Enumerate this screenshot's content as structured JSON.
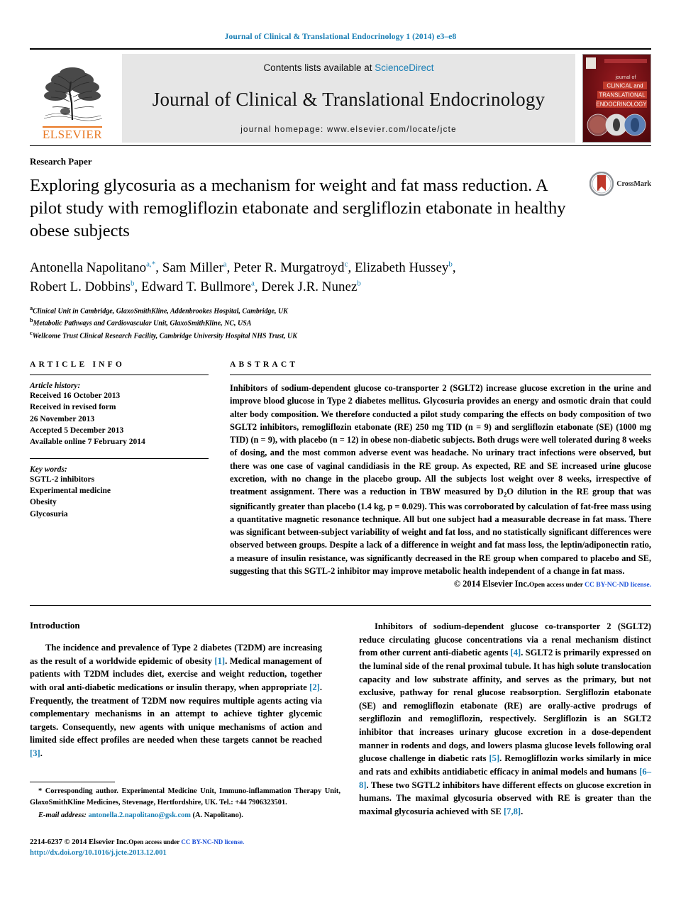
{
  "running_head": "Journal of Clinical & Translational Endocrinology 1 (2014) e3–e8",
  "masthead": {
    "contents_prefix": "Contents lists available at ",
    "sciencedirect": "ScienceDirect",
    "journal_name": "Journal of Clinical & Translational Endocrinology",
    "homepage": "journal homepage: www.elsevier.com/locate/jcte",
    "publisher_wordmark": "ELSEVIER",
    "cover": {
      "line1": "journal of",
      "line2": "CLINICAL and",
      "line3": "TRANSLATIONAL",
      "line4": "ENDOCRINOLOGY"
    }
  },
  "article": {
    "type": "Research Paper",
    "title": "Exploring glycosuria as a mechanism for weight and fat mass reduction. A pilot study with remogliflozin etabonate and sergliflozin etabonate in healthy obese subjects",
    "crossmark_label": "CrossMark",
    "authors_line1": "Antonella Napolitano",
    "authors": [
      {
        "name": "Antonella Napolitano",
        "sup": "a,*"
      },
      {
        "name": "Sam Miller",
        "sup": "a"
      },
      {
        "name": "Peter R. Murgatroyd",
        "sup": "c"
      },
      {
        "name": "Elizabeth Hussey",
        "sup": "b"
      },
      {
        "name": "Robert L. Dobbins",
        "sup": "b"
      },
      {
        "name": "Edward T. Bullmore",
        "sup": "a"
      },
      {
        "name": "Derek J.R. Nunez",
        "sup": "b"
      }
    ],
    "affiliations": [
      {
        "sup": "a",
        "text": "Clinical Unit in Cambridge, GlaxoSmithKline, Addenbrookes Hospital, Cambridge, UK"
      },
      {
        "sup": "b",
        "text": "Metabolic Pathways and Cardiovascular Unit, GlaxoSmithKline, NC, USA"
      },
      {
        "sup": "c",
        "text": "Wellcome Trust Clinical Research Facility, Cambridge University Hospital NHS Trust, UK"
      }
    ]
  },
  "article_info": {
    "heading": "ARTICLE INFO",
    "history_title": "Article history:",
    "history": [
      "Received 16 October 2013",
      "Received in revised form",
      "26 November 2013",
      "Accepted 5 December 2013",
      "Available online 7 February 2014"
    ],
    "keywords_title": "Key words:",
    "keywords": [
      "SGTL-2 inhibitors",
      "Experimental medicine",
      "Obesity",
      "Glycosuria"
    ]
  },
  "abstract": {
    "heading": "ABSTRACT",
    "text": "Inhibitors of sodium-dependent glucose co-transporter 2 (SGLT2) increase glucose excretion in the urine and improve blood glucose in Type 2 diabetes mellitus. Glycosuria provides an energy and osmotic drain that could alter body composition. We therefore conducted a pilot study comparing the effects on body composition of two SGLT2 inhibitors, remogliflozin etabonate (RE) 250 mg TID (n = 9) and sergliflozin etabonate (SE) (1000 mg TID) (n = 9), with placebo (n = 12) in obese non-diabetic subjects. Both drugs were well tolerated during 8 weeks of dosing, and the most common adverse event was headache. No urinary tract infections were observed, but there was one case of vaginal candidiasis in the RE group. As expected, RE and SE increased urine glucose excretion, with no change in the placebo group. All the subjects lost weight over 8 weeks, irrespective of treatment assignment. There was a reduction in TBW measured by D2O dilution in the RE group that was significantly greater than placebo (1.4 kg, p = 0.029). This was corroborated by calculation of fat-free mass using a quantitative magnetic resonance technique. All but one subject had a measurable decrease in fat mass. There was significant between-subject variability of weight and fat loss, and no statistically significant differences were observed between groups. Despite a lack of a difference in weight and fat mass loss, the leptin/adiponectin ratio, a measure of insulin resistance, was significantly decreased in the RE group when compared to placebo and SE, suggesting that this SGTL-2 inhibitor may improve metabolic health independent of a change in fat mass.",
    "copyright_main": "© 2014 Elsevier Inc.",
    "copyright_access": "Open access under ",
    "copyright_license": "CC BY-NC-ND license."
  },
  "introduction": {
    "heading": "Introduction",
    "left_paragraphs": [
      "The incidence and prevalence of Type 2 diabetes (T2DM) are increasing as the result of a worldwide epidemic of obesity [1]. Medical management of patients with T2DM includes diet, exercise and weight reduction, together with oral anti-diabetic medications or insulin therapy, when appropriate [2]. Frequently, the treatment of T2DM now requires multiple agents acting via complementary mechanisms in an attempt to achieve tighter glycemic targets. Consequently, new agents with unique mechanisms of action and limited side effect profiles are needed when these targets cannot be reached [3]."
    ],
    "right_paragraphs": [
      "Inhibitors of sodium-dependent glucose co-transporter 2 (SGLT2) reduce circulating glucose concentrations via a renal mechanism distinct from other current anti-diabetic agents [4]. SGLT2 is primarily expressed on the luminal side of the renal proximal tubule. It has high solute translocation capacity and low substrate affinity, and serves as the primary, but not exclusive, pathway for renal glucose reabsorption. Sergliflozin etabonate (SE) and remogliflozin etabonate (RE) are orally-active prodrugs of sergliflozin and remogliflozin, respectively. Sergliflozin is an SGLT2 inhibitor that increases urinary glucose excretion in a dose-dependent manner in rodents and dogs, and lowers plasma glucose levels following oral glucose challenge in diabetic rats [5]. Remogliflozin works similarly in mice and rats and exhibits antidiabetic efficacy in animal models and humans [6–8]. These two SGTL2 inhibitors have different effects on glucose excretion in humans. The maximal glycosuria observed with RE is greater than the maximal glycosuria achieved with SE [7,8]."
    ]
  },
  "footnote": {
    "corresponding": "* Corresponding author. Experimental Medicine Unit, Immuno-inflammation Therapy Unit, GlaxoSmithKline Medicines, Stevenage, Hertfordshire, UK. Tel.: +44 7906323501.",
    "email_label": "E-mail address:",
    "email": "antonella.2.napolitano@gsk.com",
    "email_owner": "(A. Napolitano)."
  },
  "footer": {
    "issn": "2214-6237",
    "copyright": "© 2014 Elsevier Inc.",
    "access": "Open access under ",
    "license": "CC BY-NC-ND license.",
    "doi": "http://dx.doi.org/10.1016/j.jcte.2013.12.001"
  },
  "colors": {
    "link_blue": "#1a7fb5",
    "license_blue": "#1a4fd8",
    "elsevier_orange": "#E87722",
    "masthead_grey": "#e6e6e6",
    "cover_red": "#7a0f14",
    "crossmark_red": "#c0392b"
  }
}
